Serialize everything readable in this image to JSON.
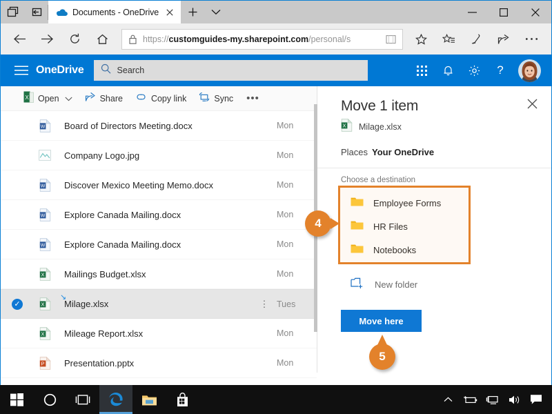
{
  "browser": {
    "tab_preview_icon": "tab-preview-icon",
    "set_aside_icon": "set-aside-tabs-icon",
    "tab": {
      "title": "Documents - OneDrive",
      "favicon": "onedrive-cloud-icon",
      "close": "close-tab-icon"
    },
    "new_tab_label": "+",
    "tab_menu_icon": "chevron-down-icon",
    "window_controls": {
      "minimize": "—",
      "maximize": "☐",
      "close": "✕"
    },
    "nav": {
      "back": "back-arrow-icon",
      "forward": "forward-arrow-icon",
      "refresh": "refresh-icon",
      "home": "home-icon"
    },
    "address": {
      "lock_icon": "padlock-icon",
      "url_scheme": "https://",
      "url_host": "customguides-my.sharepoint.com",
      "url_path": "/personal/s",
      "reading_view_icon": "reading-view-icon",
      "favorite_icon": "star-icon"
    },
    "toolbar_right": {
      "favorites": "favorites-hub-icon",
      "web_note": "web-note-pen-icon",
      "share": "share-icon",
      "more": "more-ellipsis-icon"
    }
  },
  "suitebar": {
    "waffle": "hamburger-menu-icon",
    "brand": "OneDrive",
    "search": {
      "placeholder": "Search",
      "icon": "search-icon"
    },
    "app_launcher": "app-launcher-grid-icon",
    "notifications": "bell-icon",
    "settings": "gear-icon",
    "help": "?",
    "avatar": "user-avatar"
  },
  "commandbar": {
    "open": {
      "label": "Open",
      "icon": "excel-file-icon",
      "chevron": "⌄"
    },
    "share": {
      "label": "Share",
      "icon": "share-icon"
    },
    "copy_link": {
      "label": "Copy link",
      "icon": "link-icon"
    },
    "sync": {
      "label": "Sync",
      "icon": "sync-icon"
    },
    "more": "•••"
  },
  "files": [
    {
      "name": "Board of Directors Meeting.docx",
      "icon": "word-file-icon",
      "date": "Mon",
      "selected": false
    },
    {
      "name": "Company Logo.jpg",
      "icon": "image-file-icon",
      "date": "Mon",
      "selected": false
    },
    {
      "name": "Discover Mexico Meeting Memo.docx",
      "icon": "word-file-icon",
      "date": "Mon",
      "selected": false
    },
    {
      "name": "Explore Canada Mailing.docx",
      "icon": "word-file-icon",
      "date": "Mon",
      "selected": false
    },
    {
      "name": "Explore Canada Mailing.docx",
      "icon": "word-file-icon",
      "date": "Mon",
      "selected": false
    },
    {
      "name": "Mailings Budget.xlsx",
      "icon": "excel-file-icon",
      "date": "Mon",
      "selected": false
    },
    {
      "name": "Milage.xlsx",
      "icon": "excel-file-icon",
      "date": "Tues",
      "selected": true,
      "kebab": "⋮",
      "sync_glyph": "↘"
    },
    {
      "name": "Mileage Report.xlsx",
      "icon": "excel-file-icon",
      "date": "Mon",
      "selected": false
    },
    {
      "name": "Presentation.pptx",
      "icon": "powerpoint-file-icon",
      "date": "Mon",
      "selected": false
    }
  ],
  "move_panel": {
    "title": "Move 1 item",
    "close_icon": "close-icon",
    "file": {
      "name": "Milage.xlsx",
      "icon": "excel-file-icon"
    },
    "places_label": "Places",
    "places_value": "Your OneDrive",
    "choose_label": "Choose a destination",
    "destinations": [
      {
        "label": "Employee Forms",
        "icon": "folder-icon"
      },
      {
        "label": "HR Files",
        "icon": "folder-icon"
      },
      {
        "label": "Notebooks",
        "icon": "folder-icon"
      }
    ],
    "new_folder": {
      "label": "New folder",
      "icon": "new-folder-icon"
    },
    "move_button": "Move here"
  },
  "callouts": [
    {
      "number": "4"
    },
    {
      "number": "5"
    }
  ],
  "taskbar": {
    "start": "windows-start-icon",
    "cortana": "cortana-circle-icon",
    "task_view": "task-view-icon",
    "edge": "edge-browser-icon",
    "explorer": "file-explorer-icon",
    "store": "microsoft-store-icon",
    "tray": {
      "show_hidden": "chevron-up-icon",
      "battery": "battery-icon",
      "network": "network-icon",
      "volume": "volume-icon",
      "action_center": "action-center-icon"
    }
  },
  "colors": {
    "accent_blue": "#0078d4",
    "button_blue": "#0f78d4",
    "callout_orange": "#e3822b",
    "highlight_border": "#e3822b",
    "taskbar": "#101010"
  }
}
